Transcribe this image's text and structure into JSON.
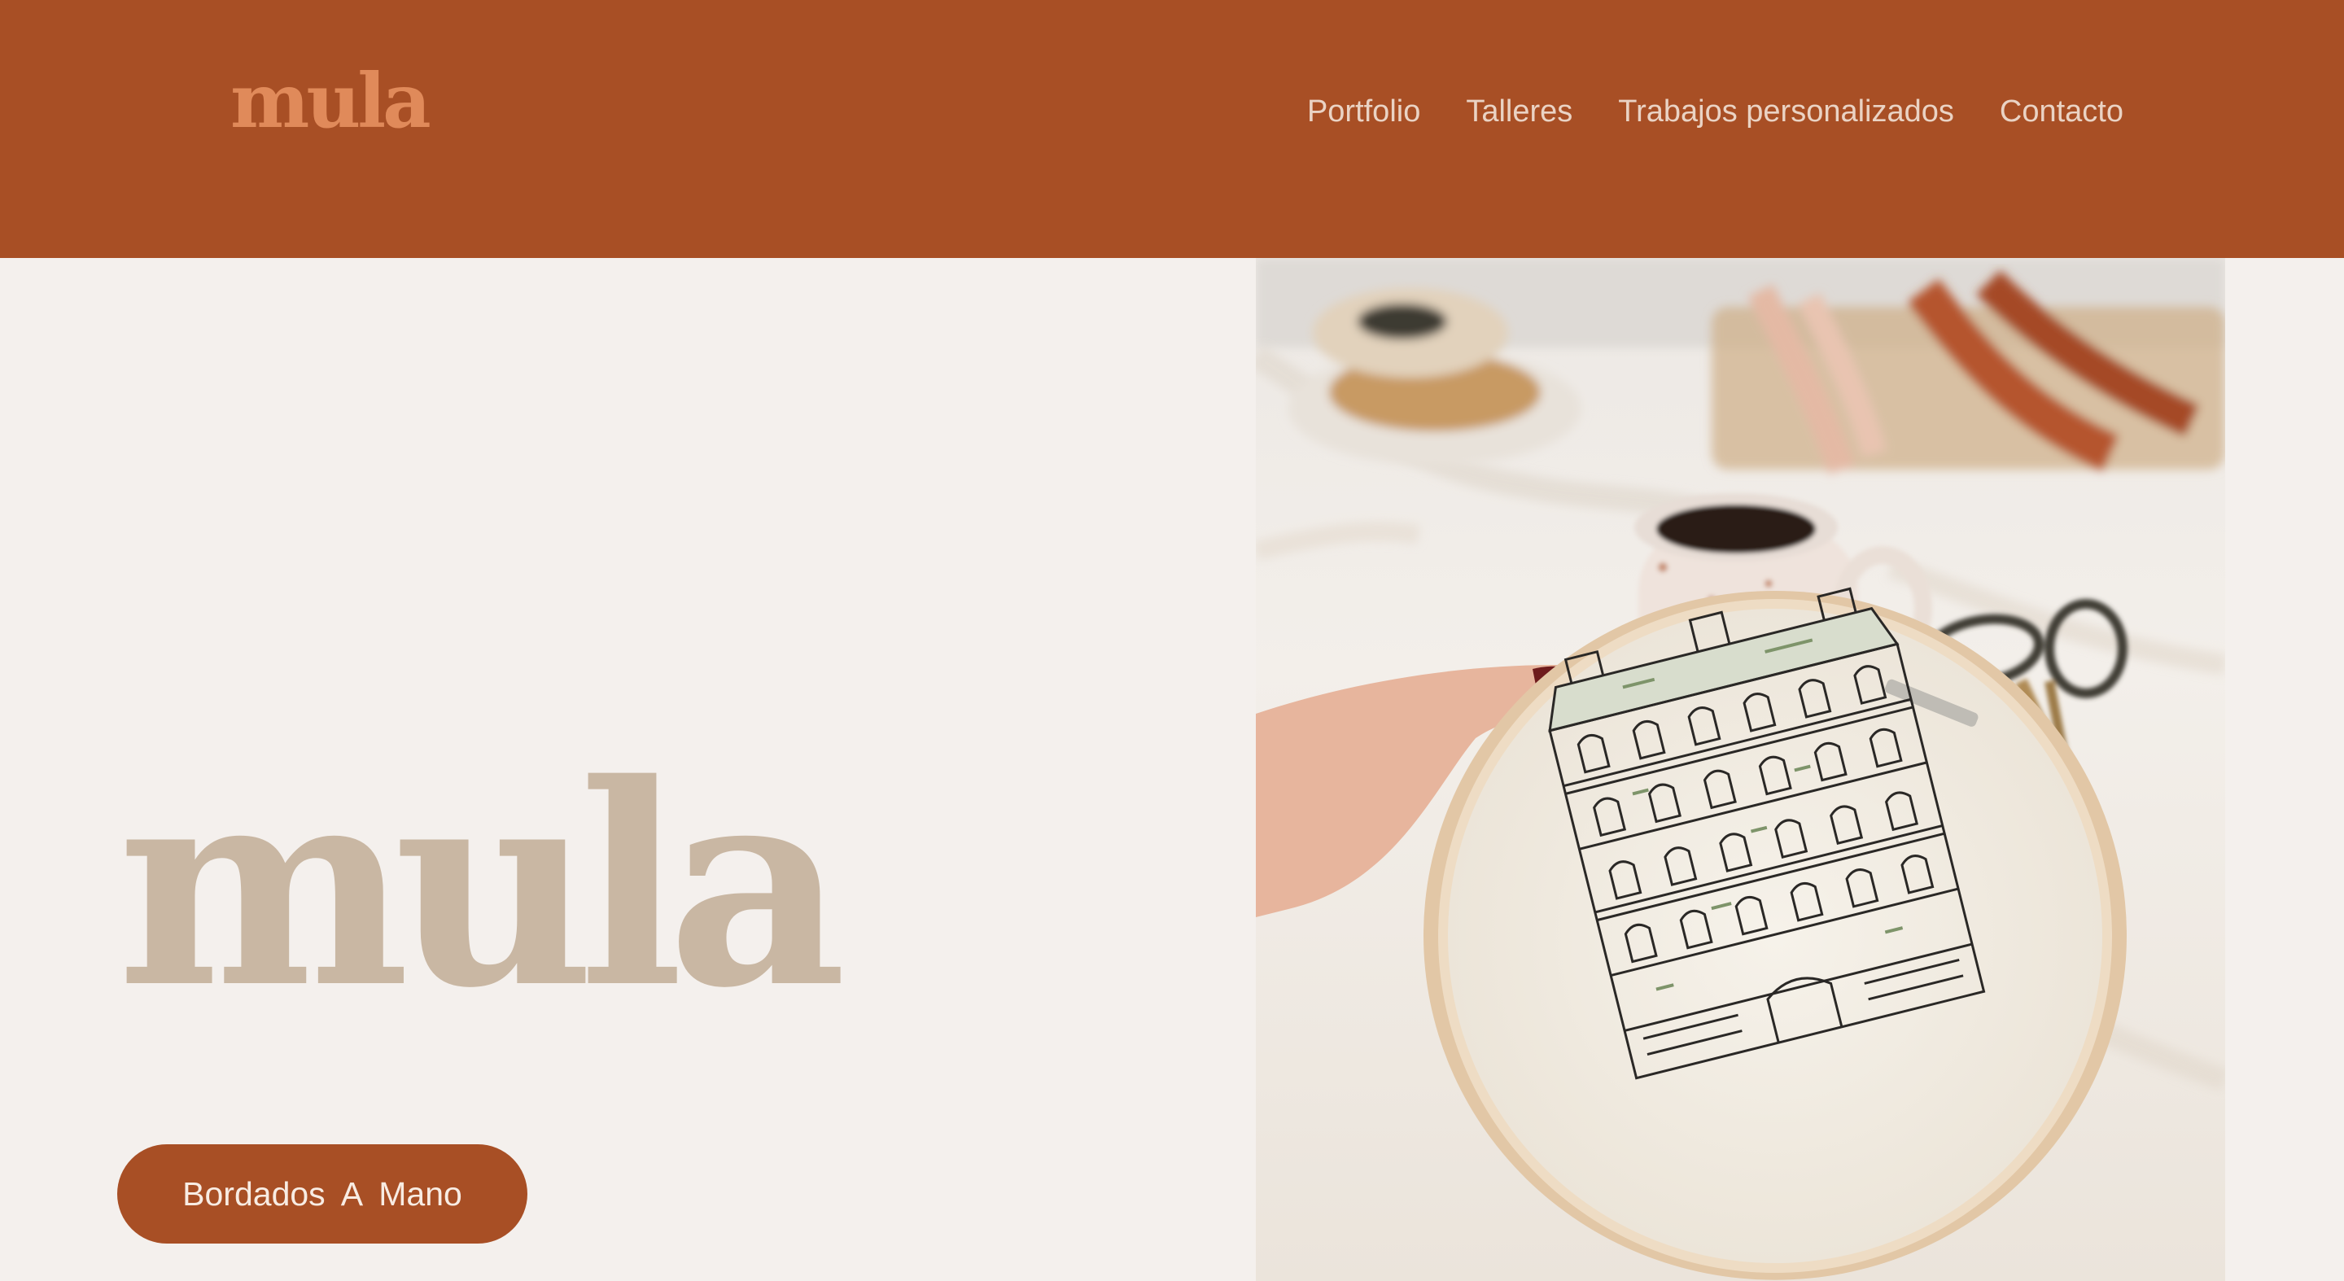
{
  "brand": {
    "logo_text": "mula"
  },
  "nav": {
    "items": [
      {
        "label": "Portfolio"
      },
      {
        "label": "Talleres"
      },
      {
        "label": "Trabajos personalizados"
      },
      {
        "label": "Contacto"
      }
    ]
  },
  "hero": {
    "title": "mula",
    "cta_label": "Bordados  A  Mano"
  },
  "colors": {
    "header_bg": "#a84f25",
    "logo": "#e08a5a",
    "page_bg": "#f4f0ed",
    "hero_title": "#c9b7a3",
    "cta_bg": "#a84f25"
  }
}
